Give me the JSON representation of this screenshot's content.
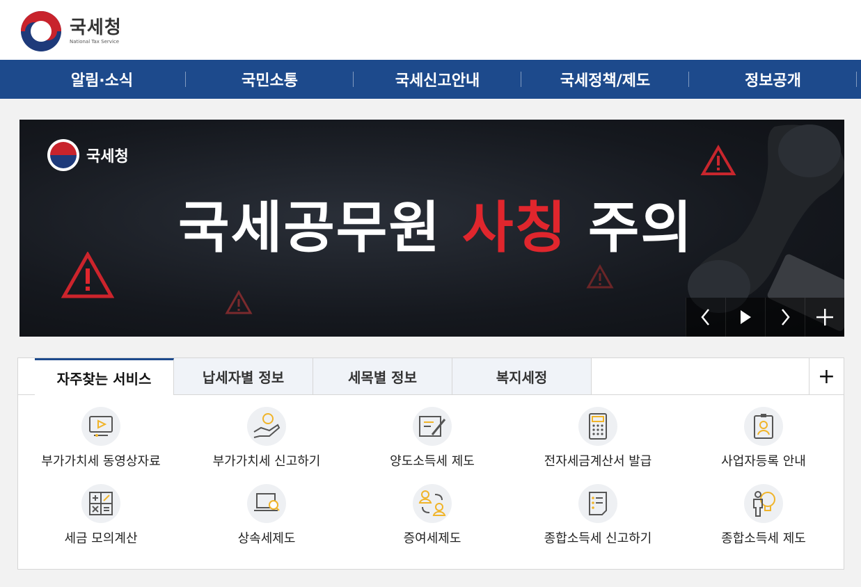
{
  "header": {
    "logo_ko": "국세청",
    "logo_en": "National Tax Service"
  },
  "nav": [
    {
      "label": "알림·소식"
    },
    {
      "label": "국민소통"
    },
    {
      "label": "국세신고안내"
    },
    {
      "label": "국세정책/제도"
    },
    {
      "label": "정보공개"
    }
  ],
  "banner": {
    "logo_label": "국세청",
    "headline_pre": "국세공무원 ",
    "headline_red": "사칭",
    "headline_post": " 주의",
    "controls": [
      "prev",
      "play",
      "next",
      "more"
    ]
  },
  "services": {
    "tabs": [
      {
        "label": "자주찾는 서비스",
        "active": true
      },
      {
        "label": "납세자별 정보"
      },
      {
        "label": "세목별 정보"
      },
      {
        "label": "복지세정"
      }
    ],
    "more": "+",
    "items": [
      {
        "label": "부가가치세 동영상자료",
        "icon": "video-monitor-icon"
      },
      {
        "label": "부가가치세 신고하기",
        "icon": "hand-person-icon"
      },
      {
        "label": "양도소득세 제도",
        "icon": "document-pen-icon"
      },
      {
        "label": "전자세금계산서 발급",
        "icon": "calculator-icon"
      },
      {
        "label": "사업자등록 안내",
        "icon": "id-card-icon"
      },
      {
        "label": "세금 모의계산",
        "icon": "math-symbols-icon"
      },
      {
        "label": "상속세제도",
        "icon": "laptop-search-icon"
      },
      {
        "label": "증여세제도",
        "icon": "people-exchange-icon"
      },
      {
        "label": "종합소득세 신고하기",
        "icon": "checklist-icon"
      },
      {
        "label": "종합소득세 제도",
        "icon": "person-bulb-icon"
      }
    ]
  },
  "colors": {
    "nav_bg": "#1d4a8c",
    "accent_red": "#e0262d",
    "icon_accent": "#f0b429"
  }
}
